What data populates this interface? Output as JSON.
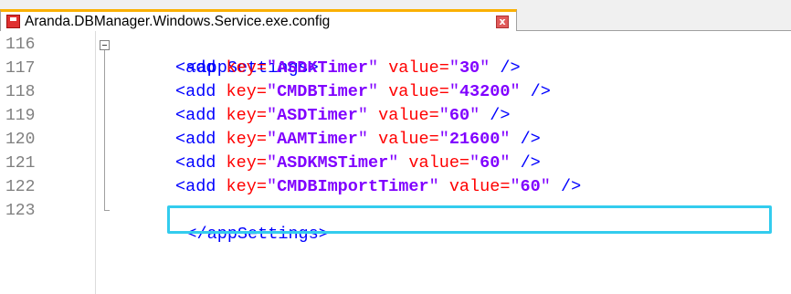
{
  "tab": {
    "title": "Aranda.DBManager.Windows.Service.exe.config",
    "close_glyph": "x"
  },
  "colors": {
    "tab_accent": "#fab000",
    "highlight": "#33ccee",
    "tag": "#0000ff",
    "attribute": "#ff0000",
    "value": "#8000ff"
  },
  "lines": [
    {
      "no": "116",
      "open": "<appSettings>"
    },
    {
      "no": "117",
      "tag": "<add",
      "key_attr": "key=",
      "key_val": "ASDKTimer",
      "val_attr": "value=",
      "val_val": "30",
      "close": "/>"
    },
    {
      "no": "118",
      "tag": "<add",
      "key_attr": "key=",
      "key_val": "CMDBTimer",
      "val_attr": "value=",
      "val_val": "43200",
      "close": "/>"
    },
    {
      "no": "119",
      "tag": "<add",
      "key_attr": "key=",
      "key_val": "ASDTimer",
      "val_attr": "value=",
      "val_val": "60",
      "close": "/>"
    },
    {
      "no": "120",
      "tag": "<add",
      "key_attr": "key=",
      "key_val": "AAMTimer",
      "val_attr": "value=",
      "val_val": "21600",
      "close": "/>"
    },
    {
      "no": "121",
      "tag": "<add",
      "key_attr": "key=",
      "key_val": "ASDKMSTimer",
      "val_attr": "value=",
      "val_val": "60",
      "close": "/>"
    },
    {
      "no": "122",
      "tag": "<add",
      "key_attr": "key=",
      "key_val": "CMDBImportTimer",
      "val_attr": "value=",
      "val_val": "60",
      "close": "/>"
    },
    {
      "no": "123",
      "open": "</appSettings>"
    }
  ]
}
